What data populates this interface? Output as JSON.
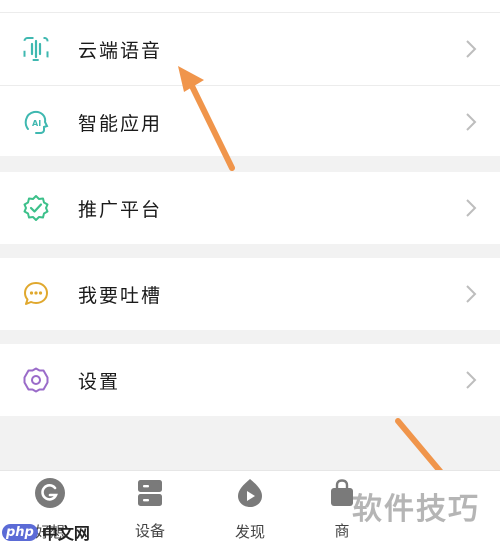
{
  "menu": {
    "items": [
      {
        "label": "云端语音",
        "icon": "waveform-icon"
      },
      {
        "label": "智能应用",
        "icon": "ai-head-icon"
      },
      {
        "label": "推广平台",
        "icon": "badge-check-icon"
      },
      {
        "label": "我要吐槽",
        "icon": "chat-bubble-icon"
      },
      {
        "label": "设置",
        "icon": "gear-icon"
      }
    ]
  },
  "tabbar": {
    "items": [
      {
        "label": "好想",
        "icon": "home-icon"
      },
      {
        "label": "设备",
        "icon": "device-icon"
      },
      {
        "label": "发现",
        "icon": "discover-icon"
      },
      {
        "label": "商",
        "icon": "shop-icon"
      }
    ]
  },
  "watermark": {
    "right_text": "软件技巧",
    "left_badge": "php",
    "left_site": "中文网"
  },
  "colors": {
    "arrow": "#f0954b",
    "icon_teal": "#3fb8b0",
    "icon_green": "#3cc08a",
    "icon_yellow": "#e0a82e",
    "icon_purple": "#9a6bc9",
    "tab_gray": "#7a7a7a"
  }
}
